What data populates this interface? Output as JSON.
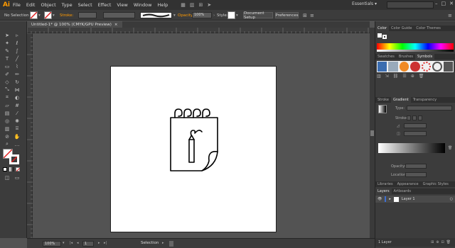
{
  "app": {
    "logo": "Ai",
    "workspace": "Essentials ▾"
  },
  "menu": [
    "File",
    "Edit",
    "Object",
    "Type",
    "Select",
    "Effect",
    "View",
    "Window",
    "Help"
  ],
  "control_bar": {
    "selection": "No Selection",
    "stroke_label": "Stroke:",
    "opacity_label": "Opacity:",
    "opacity_value": "100%",
    "style_label": "Style:",
    "document_setup": "Document Setup",
    "preferences": "Preferences"
  },
  "document": {
    "tab_title": "Untitled-1* @ 100% (CMYK/GPU Preview)",
    "close": "×"
  },
  "status": {
    "zoom": "100%",
    "artboard_num": "1",
    "tool": "Selection"
  },
  "panels": {
    "color_tabs": [
      "Color",
      "Color Guide",
      "Color Themes"
    ],
    "swatch_tabs": [
      "Swatches",
      "Brushes",
      "Symbols"
    ],
    "stroke_tabs": [
      "Stroke",
      "Gradient",
      "Transparency"
    ],
    "gradient_type_label": "Type:",
    "gradient_stroke_label": "Stroke:",
    "opacity_label": "Opacity:",
    "location_label": "Location:",
    "library_tabs": [
      "Libraries",
      "Appearance",
      "Graphic Styles"
    ],
    "layer_tabs": [
      "Layers",
      "Artboards"
    ],
    "layer_name": "Layer 1",
    "layer_count": "1 Layer"
  }
}
